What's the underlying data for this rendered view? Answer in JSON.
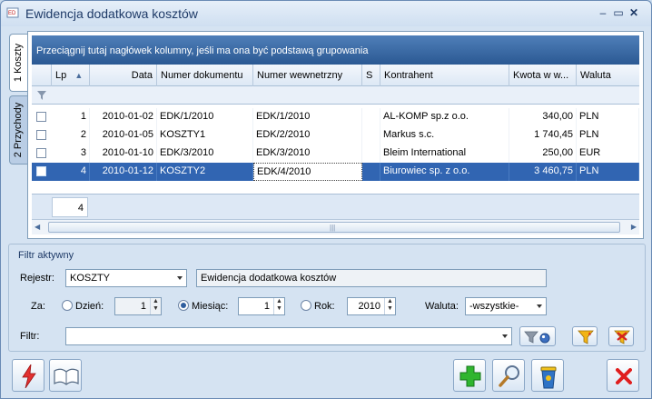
{
  "window": {
    "title": "Ewidencja dodatkowa kosztów"
  },
  "tabs": [
    {
      "label": "1 Koszty"
    },
    {
      "label": "2 Przychody"
    }
  ],
  "grid": {
    "group_hint": "Przeciągnij tutaj nagłówek kolumny, jeśli ma ona być podstawą grupowania",
    "columns": {
      "lp": "Lp",
      "data": "Data",
      "numer_dokumentu": "Numer dokumentu",
      "numer_wewnetrzny": "Numer wewnetrzny",
      "s": "S",
      "kontrahent": "Kontrahent",
      "kwota": "Kwota w w...",
      "waluta": "Waluta"
    },
    "rows": [
      {
        "lp": "1",
        "data": "2010-01-02",
        "numer_dokumentu": "EDK/1/2010",
        "numer_wewnetrzny": "EDK/1/2010",
        "s": "",
        "kontrahent": "AL-KOMP sp.z o.o.",
        "kwota": "340,00",
        "waluta": "PLN"
      },
      {
        "lp": "2",
        "data": "2010-01-05",
        "numer_dokumentu": "KOSZTY1",
        "numer_wewnetrzny": "EDK/2/2010",
        "s": "",
        "kontrahent": "Markus s.c.",
        "kwota": "1 740,45",
        "waluta": "PLN"
      },
      {
        "lp": "3",
        "data": "2010-01-10",
        "numer_dokumentu": "EDK/3/2010",
        "numer_wewnetrzny": "EDK/3/2010",
        "s": "",
        "kontrahent": "Bleim International",
        "kwota": "250,00",
        "waluta": "EUR"
      },
      {
        "lp": "4",
        "data": "2010-01-12",
        "numer_dokumentu": "KOSZTY2",
        "numer_wewnetrzny": "EDK/4/2010",
        "s": "",
        "kontrahent": "Biurowiec sp. z o.o.",
        "kwota": "3 460,75",
        "waluta": "PLN"
      }
    ],
    "selected_row": 4,
    "footer_count": "4"
  },
  "filter": {
    "title": "Filtr aktywny",
    "rejestr_label": "Rejestr:",
    "rejestr_value": "KOSZTY",
    "rejestr_desc": "Ewidencja dodatkowa kosztów",
    "za_label": "Za:",
    "dzien_label": "Dzień:",
    "dzien_value": "1",
    "miesiac_label": "Miesiąc:",
    "miesiac_value": "1",
    "rok_label": "Rok:",
    "rok_value": "2010",
    "selected_period": "Miesiąc",
    "waluta_label": "Waluta:",
    "waluta_value": "-wszystkie-",
    "filtr_label": "Filtr:",
    "filtr_value": ""
  },
  "icons": {
    "lightning": "lightning-icon",
    "book": "book-icon",
    "add": "plus-icon",
    "search": "magnifier-icon",
    "delete": "trash-icon",
    "close": "close-icon"
  },
  "colors": {
    "selection": "#3165b2",
    "group_bar": "#3b6aa6",
    "window_bg": "#d5e3f2"
  }
}
